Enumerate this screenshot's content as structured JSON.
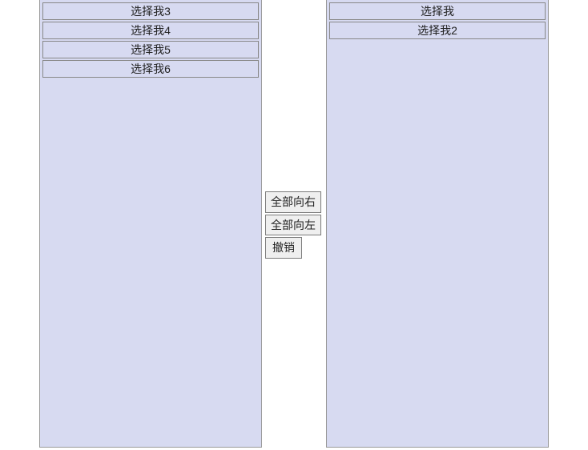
{
  "left_list": {
    "items": [
      {
        "label": "选择我3"
      },
      {
        "label": "选择我4"
      },
      {
        "label": "选择我5"
      },
      {
        "label": "选择我6"
      }
    ]
  },
  "right_list": {
    "items": [
      {
        "label": "选择我"
      },
      {
        "label": "选择我2"
      }
    ]
  },
  "buttons": {
    "all_right": "全部向右",
    "all_left": "全部向左",
    "undo": "撤销"
  }
}
